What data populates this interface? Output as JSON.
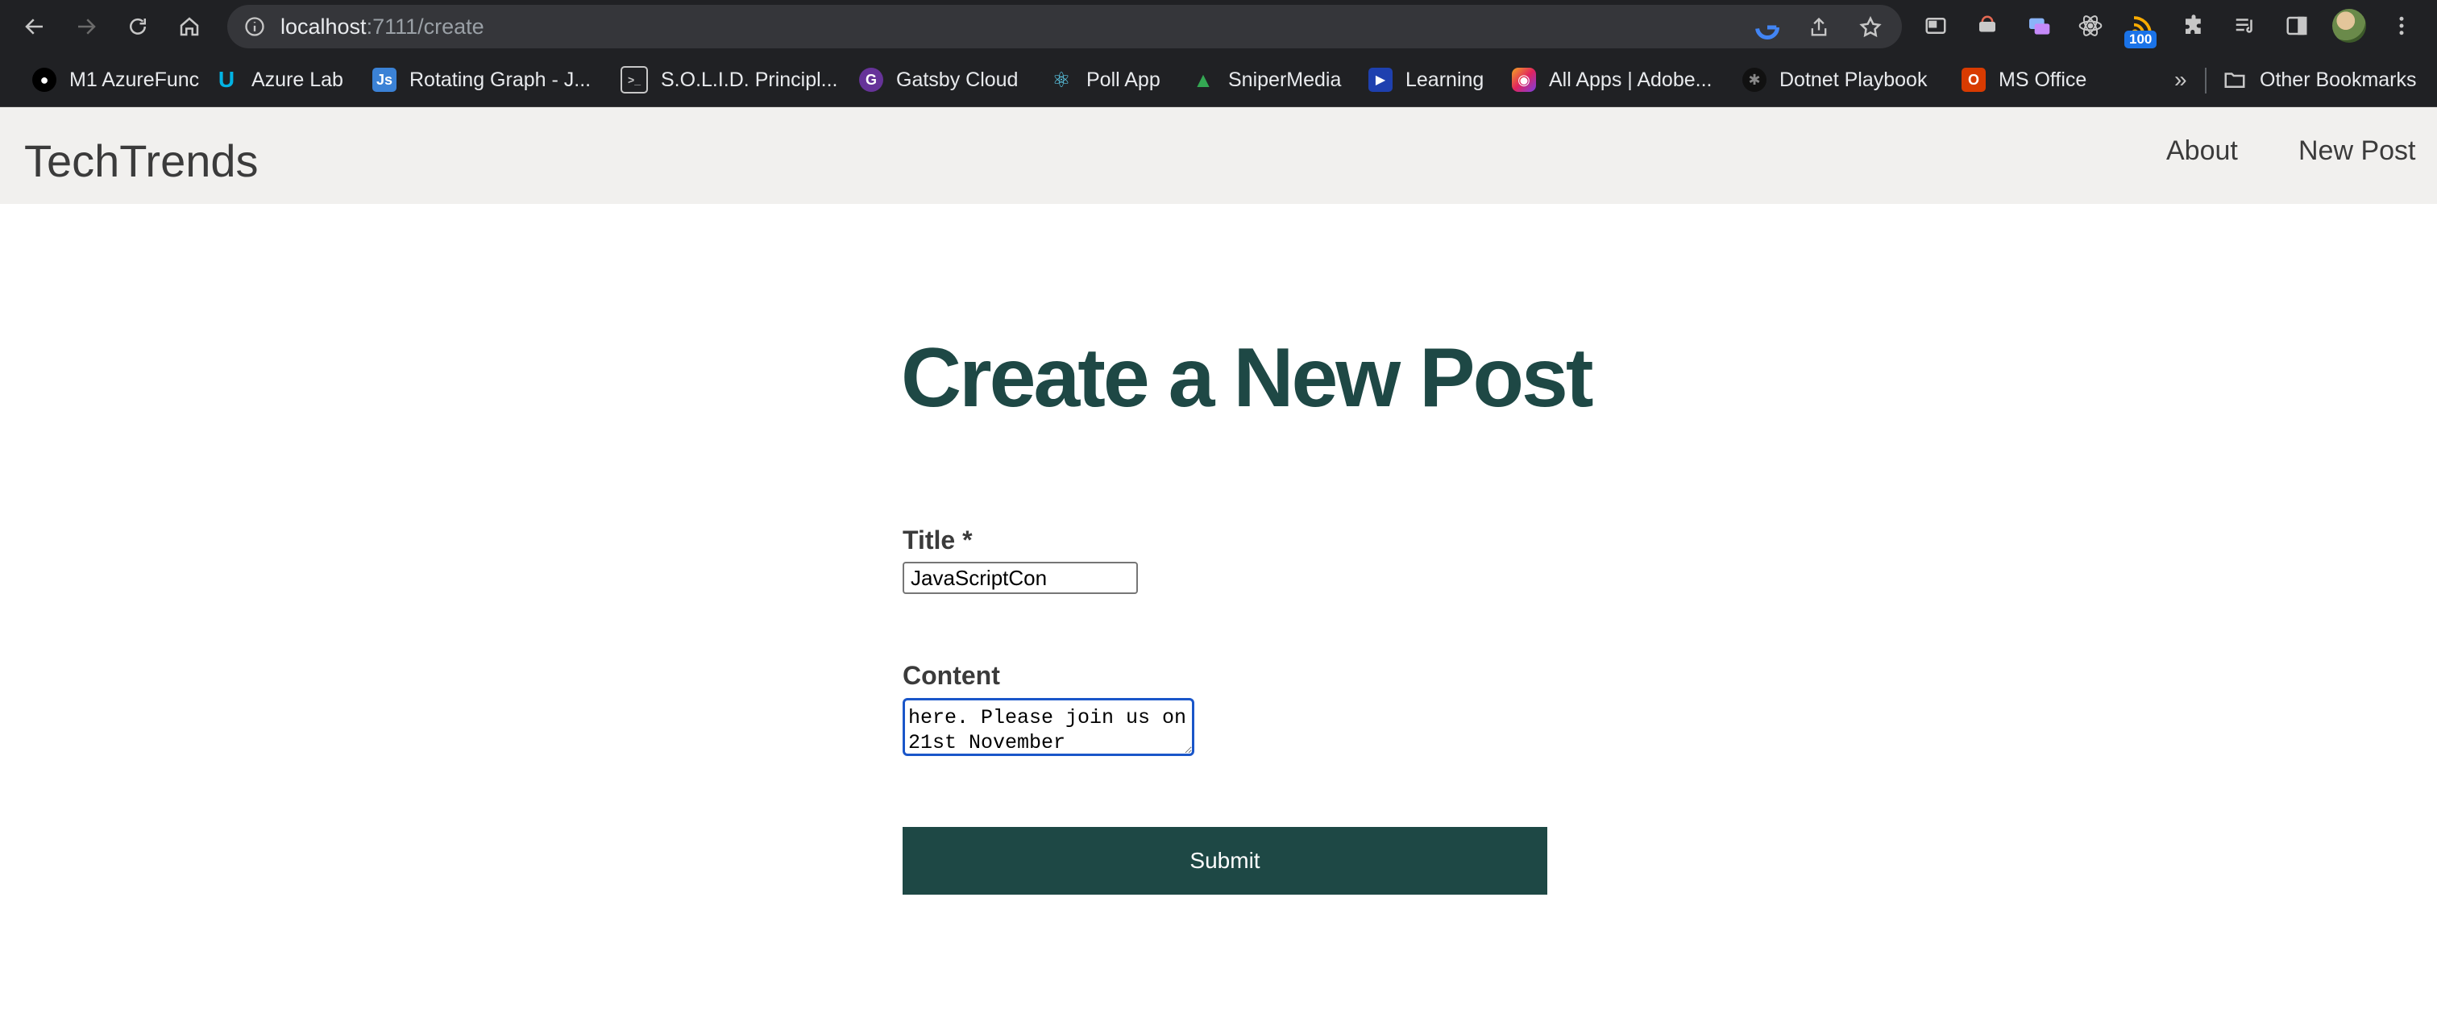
{
  "browser": {
    "url_host": "localhost",
    "url_rest": ":7111/create",
    "extension_badge": "100",
    "bookmarks": [
      {
        "label": "M1 AzureFunc",
        "icon": "github-icon"
      },
      {
        "label": "Azure Lab",
        "icon": "udacity-icon"
      },
      {
        "label": "Rotating Graph - J...",
        "icon": "js-icon"
      },
      {
        "label": "S.O.L.I.D. Principl...",
        "icon": "terminal-icon"
      },
      {
        "label": "Gatsby Cloud",
        "icon": "gatsby-icon"
      },
      {
        "label": "Poll App",
        "icon": "react-icon"
      },
      {
        "label": "SniperMedia",
        "icon": "drive-icon"
      },
      {
        "label": "Learning",
        "icon": "video-icon"
      },
      {
        "label": "All Apps | Adobe...",
        "icon": "adobe-icon"
      },
      {
        "label": "Dotnet Playbook",
        "icon": "dotnet-icon"
      },
      {
        "label": "MS Office",
        "icon": "office-icon"
      }
    ],
    "overflow_label": "»",
    "other_bookmarks": "Other Bookmarks"
  },
  "app": {
    "brand": "TechTrends",
    "nav": {
      "about": "About",
      "new_post": "New Post"
    }
  },
  "form": {
    "heading": "Create a New Post",
    "title_label": "Title *",
    "title_value": "JavaScriptCon",
    "content_label": "Content",
    "content_value": "here. Please join us on 21st November",
    "submit_label": "Submit"
  }
}
